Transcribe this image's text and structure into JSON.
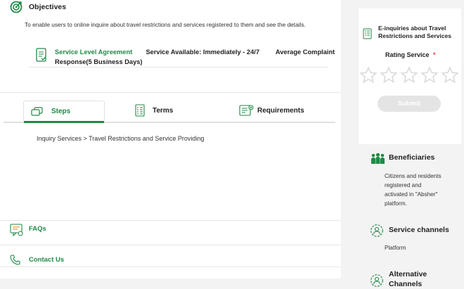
{
  "objectives": {
    "title": "Objectives",
    "description": "To enable users to online inquire about travel restrictions and services registered to them and see the details."
  },
  "sla": {
    "label": "Service Level Agreement",
    "availability": "Service Available: Immediately - 24/7",
    "complaint_line1": "Average Complaint",
    "complaint_line2": "Response(5 Business Days)"
  },
  "tabs": [
    {
      "label": "Steps",
      "icon": "steps-icon",
      "active": true
    },
    {
      "label": "Terms",
      "icon": "terms-icon",
      "active": false
    },
    {
      "label": "Requirements",
      "icon": "requirements-icon",
      "active": false
    }
  ],
  "steps_content": "Inquiry Services > Travel Restrictions and Service Providing",
  "faqs": {
    "label": "FAQs"
  },
  "contact": {
    "label": "Contact Us"
  },
  "einquiries": {
    "title_line1": "E-inquiries about Travel",
    "title_line2": "Restrictions and Services",
    "rating_label": "Rating Service",
    "required_mark": "*",
    "submit_label": "Submit"
  },
  "beneficiaries": {
    "title": "Beneficiaries",
    "lines": [
      "Citizens and residents",
      "registered and",
      "activated in \"Absher\"",
      "platform."
    ]
  },
  "service_channels": {
    "title": "Service channels",
    "value": "Platform"
  },
  "alternative_channels": {
    "title_line1": "Alternative",
    "title_line2": "Channels"
  },
  "colors": {
    "accent": "#1f8a45",
    "star": "#d9d9d9",
    "submit_bg": "#e4e4e4",
    "required": "#e53935"
  }
}
